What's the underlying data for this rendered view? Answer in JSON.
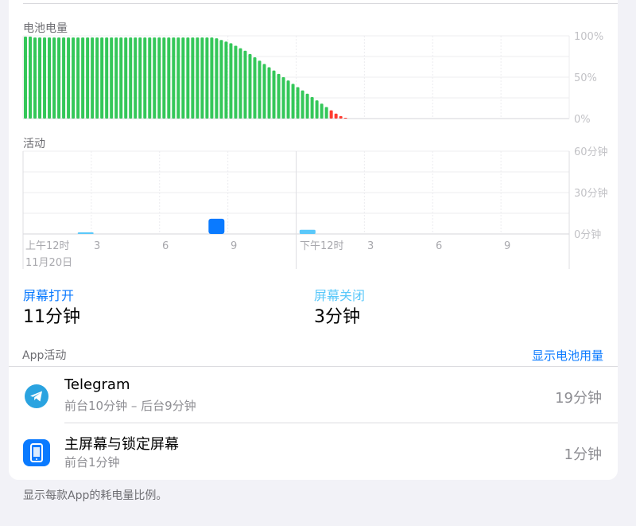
{
  "battery": {
    "title": "电池电量",
    "ticks": [
      "100%",
      "50%",
      "0%"
    ]
  },
  "activity": {
    "title": "活动",
    "ticks": [
      "60分钟",
      "30分钟",
      "0分钟"
    ],
    "time_labels": [
      "上午12时",
      "3",
      "6",
      "9",
      "下午12时",
      "3",
      "6",
      "9"
    ],
    "date_label": "11月20日"
  },
  "chart_data": [
    {
      "type": "bar",
      "title": "电池电量",
      "ylim": [
        0,
        100
      ],
      "yticks": [
        "100%",
        "50%",
        "0%"
      ],
      "values": [
        99,
        99,
        98,
        98,
        98,
        98,
        98,
        98,
        98,
        98,
        98,
        98,
        98,
        98,
        98,
        98,
        98,
        98,
        98,
        98,
        98,
        98,
        98,
        98,
        98,
        98,
        98,
        98,
        98,
        98,
        98,
        98,
        98,
        98,
        98,
        98,
        98,
        98,
        98,
        98,
        97,
        95,
        93,
        91,
        88,
        85,
        82,
        78,
        74,
        70,
        66,
        62,
        58,
        54,
        50,
        46,
        42,
        38,
        34,
        30,
        26,
        22,
        18,
        14,
        10,
        6,
        3,
        1
      ],
      "colors": {
        "normal": "#34c759",
        "low": "#ff3b30"
      },
      "low_from_index": 64,
      "grid": true
    },
    {
      "type": "bar",
      "title": "活动",
      "ylim": [
        0,
        60
      ],
      "yticks": [
        "60分钟",
        "30分钟",
        "0分钟"
      ],
      "x": [
        2.75,
        8.5,
        12.5
      ],
      "screen_on": [
        0,
        11,
        0
      ],
      "screen_off": [
        1,
        0,
        3
      ],
      "colors": {
        "screen_on": "#0a7aff",
        "screen_off": "#5ac8fa"
      },
      "grid": true
    }
  ],
  "metrics": {
    "screen_on": {
      "label": "屏幕打开",
      "value": "11分钟",
      "color": "#0a7aff"
    },
    "screen_off": {
      "label": "屏幕关闭",
      "value": "3分钟",
      "color": "#5ac8fa"
    }
  },
  "app_activity": {
    "title": "App活动",
    "show_battery_label": "显示电池用量",
    "apps": [
      {
        "name": "Telegram",
        "detail": "前台10分钟 – 后台9分钟",
        "duration": "19分钟",
        "icon": "telegram-icon"
      },
      {
        "name": "主屏幕与锁定屏幕",
        "detail": "前台1分钟",
        "duration": "1分钟",
        "icon": "home-lock-screen-icon"
      }
    ]
  },
  "footer": "显示每款App的耗电量比例。"
}
